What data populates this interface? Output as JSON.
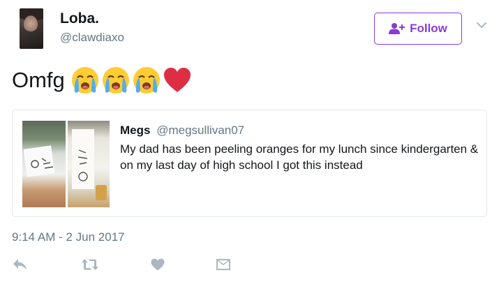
{
  "user": {
    "display_name": "Loba.",
    "handle": "@clawdiaxo"
  },
  "follow_button": {
    "label": "Follow",
    "color": "#8a3bd6"
  },
  "tweet": {
    "text": "Omfg",
    "emojis": [
      "loudly-crying-face",
      "loudly-crying-face",
      "loudly-crying-face",
      "red-heart"
    ],
    "timestamp": "9:14 AM - 2 Jun 2017"
  },
  "quoted_tweet": {
    "name": "Megs",
    "handle": "@megsullivan07",
    "text": "My dad has been peeling oranges for my lunch since kindergarten & on my last day of high school I got this instead"
  },
  "actions": [
    "reply-icon",
    "retweet-icon",
    "like-icon",
    "direct-message-icon"
  ],
  "colors": {
    "text": "#14171a",
    "muted": "#657786",
    "icon": "#aab8c2",
    "border": "#e1e8ed"
  }
}
